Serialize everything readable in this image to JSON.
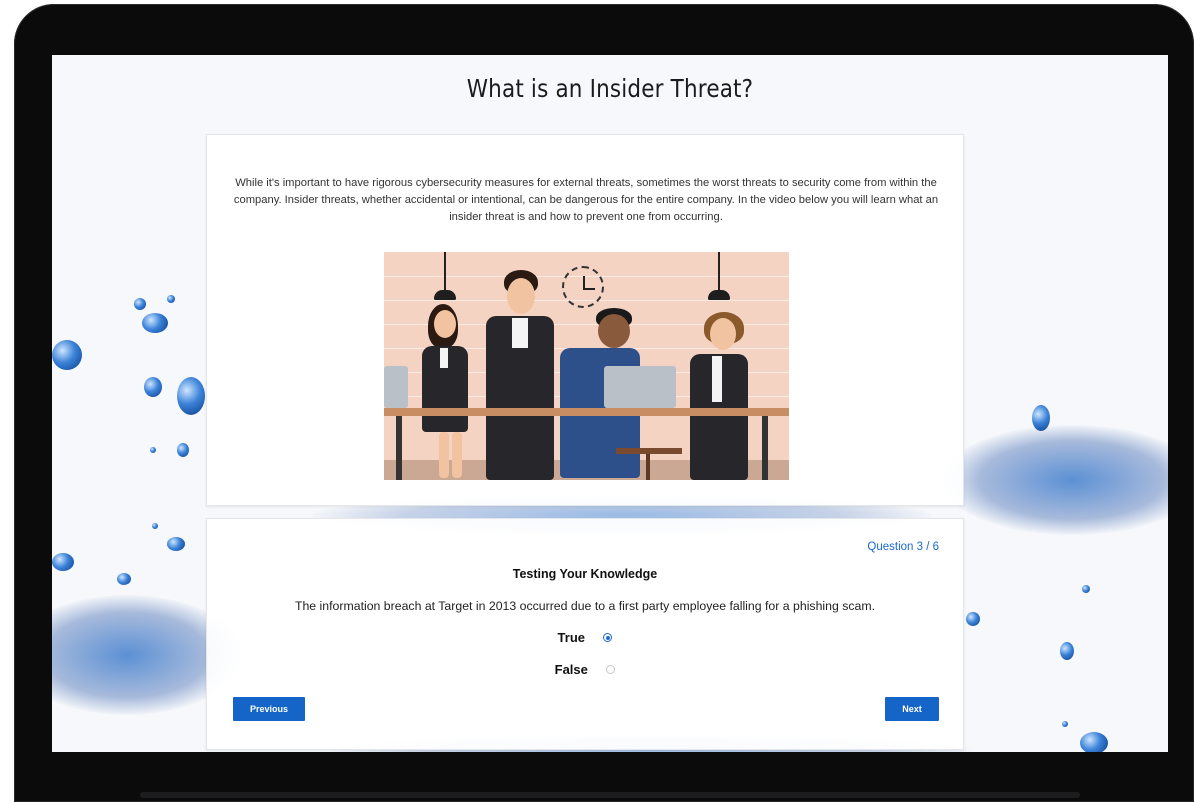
{
  "page": {
    "title": "What is an Insider Threat?",
    "intro": "While it's important to have rigorous cybersecurity measures for external threats, sometimes the worst threats to security come from within the company. Insider threats, whether accidental or intentional, can be dangerous for the entire company. In the video below you will learn what an insider threat is and how to prevent one from occurring."
  },
  "quiz": {
    "counter": "Question 3 / 6",
    "heading": "Testing Your Knowledge",
    "question": "The information breach at Target in 2013 occurred due to a first party employee falling for a phishing scam.",
    "options": [
      {
        "label": "True",
        "selected": true
      },
      {
        "label": "False",
        "selected": false
      }
    ],
    "previous_label": "Previous",
    "next_label": "Next"
  },
  "colors": {
    "accent": "#1565c8",
    "counter": "#1b6ad0",
    "frame": "#0b0b0c"
  }
}
